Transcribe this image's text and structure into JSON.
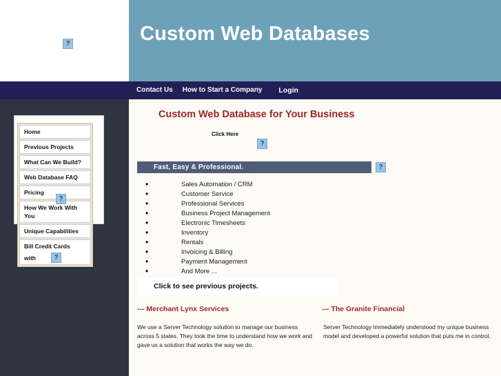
{
  "header": {
    "site_title": "Custom Web Databases",
    "banner_color": "#6ea1b8",
    "logo_icon": "broken-image-icon"
  },
  "nav": {
    "background": "#211f56",
    "items": [
      {
        "label": "Contact Us"
      },
      {
        "label": "How to Start a Company"
      },
      {
        "label": "Login"
      }
    ]
  },
  "sidebar": {
    "items": [
      {
        "label": "Home"
      },
      {
        "label": "Previous Projects"
      },
      {
        "label": "What Can We Build?"
      },
      {
        "label": "Web Database FAQ"
      },
      {
        "label": "Pricing"
      },
      {
        "label": "How We Work With You"
      },
      {
        "label": "Unique Capabilities"
      },
      {
        "label": "Bill Credit Cards",
        "label2": "with",
        "icon": "broken-image-icon"
      }
    ],
    "bottom_icon": "broken-image-icon"
  },
  "main": {
    "page_heading": "Custom Web Database for Your Business",
    "heading_color": "#9e2626",
    "click_here_label": "Click Here",
    "click_here_icon": "broken-image-icon",
    "section_bar": {
      "label": "Fast, Easy & Professional.",
      "color": "#4f5d77",
      "icon": "broken-image-icon"
    },
    "features": [
      "Sales Automation / CRM",
      "Customer Service",
      "Professional Services",
      "Business Project Management",
      "Electronic Timesheets",
      "Inventory",
      "Rentals",
      "Invoicing & Billing",
      "Payment Management",
      "And More ..."
    ],
    "projects_band_label": "Click to see previous projects.",
    "testimonials": [
      {
        "title": "--- Merchant Lynx Services",
        "body": "We use a Server Technology solution to manage our business across 5 states. They took the time to understand how we work and gave us a solution that works the way we do."
      },
      {
        "title": "--- The Granite Financial",
        "body": "Server Technology immediately understood my unique business model and developed a powerful solution that puts me in control."
      }
    ]
  }
}
